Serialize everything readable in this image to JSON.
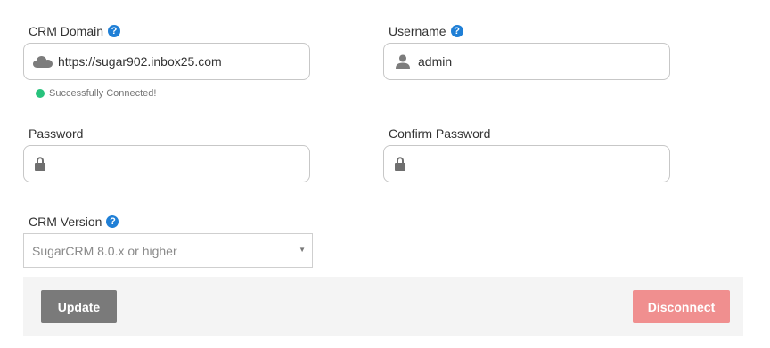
{
  "crm_domain": {
    "label": "CRM Domain",
    "help": "?",
    "value": "https://sugar902.inbox25.com",
    "icon": "cloud-icon",
    "status": "Successfully Connected!",
    "status_color": "#27c27c"
  },
  "username": {
    "label": "Username",
    "help": "?",
    "value": "admin",
    "icon": "user-icon"
  },
  "password": {
    "label": "Password",
    "value": "",
    "icon": "lock-icon"
  },
  "confirm_password": {
    "label": "Confirm Password",
    "value": "",
    "icon": "lock-icon"
  },
  "crm_version": {
    "label": "CRM Version",
    "help": "?",
    "selected": "SugarCRM 8.0.x or higher"
  },
  "actions": {
    "update_label": "Update",
    "disconnect_label": "Disconnect"
  },
  "colors": {
    "help_icon": "#1f7fd6",
    "update_button": "#7a7a7a",
    "disconnect_button": "#f08f8f"
  }
}
